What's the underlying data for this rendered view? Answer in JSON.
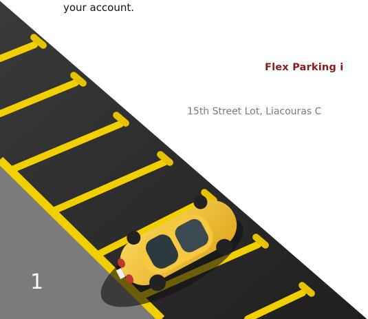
{
  "intro": {
    "text_tail": "your account."
  },
  "section": {
    "heading": "Flex Parking i",
    "location": "15th Street Lot, Liacouras C"
  },
  "page": {
    "number": "1"
  },
  "colors": {
    "heading": "#8b1a1a",
    "location": "#7a7a7a",
    "asphalt": "#2f2f2f",
    "lines": "#f2d000",
    "car": "#f3c73a"
  },
  "photo": {
    "subject": "yellow-car-parking-lot-photo"
  }
}
